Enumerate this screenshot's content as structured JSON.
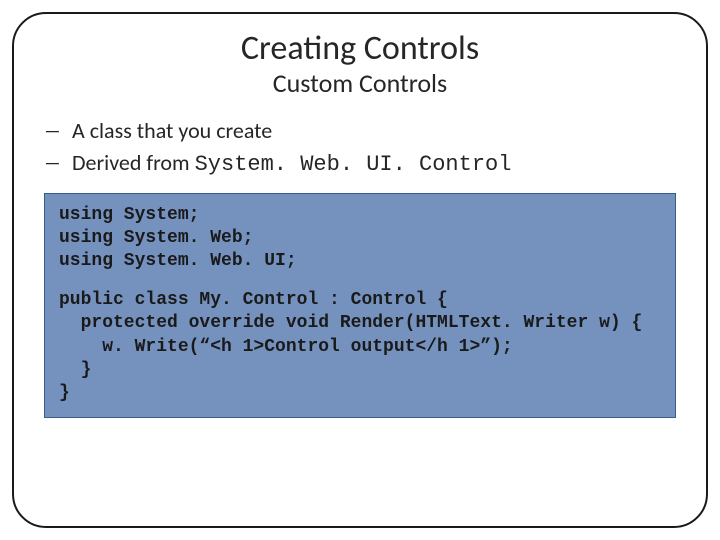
{
  "title": "Creating Controls",
  "subtitle": "Custom Controls",
  "bullets": [
    {
      "glyph": "─",
      "text": "A class that you create"
    },
    {
      "glyph": "─",
      "prefix": "Derived from ",
      "mono": "System. Web. UI. Control"
    }
  ],
  "code": {
    "block1": "using System;\nusing System. Web;\nusing System. Web. UI;",
    "block2": "public class My. Control : Control {\n  protected override void Render(HTMLText. Writer w) {\n    w. Write(“<h 1>Control output</h 1>”);\n  }\n}"
  }
}
